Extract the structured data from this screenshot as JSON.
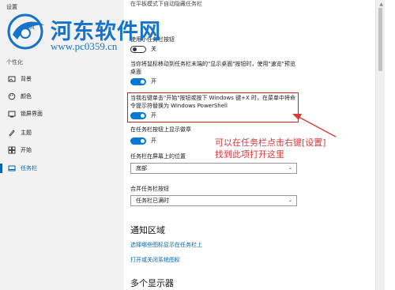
{
  "window": {
    "title": "设置"
  },
  "sidebar": {
    "home_label": "主页",
    "section": "个性化",
    "items": [
      {
        "label": "背景",
        "icon": "image-icon"
      },
      {
        "label": "颜色",
        "icon": "palette-icon"
      },
      {
        "label": "锁屏界面",
        "icon": "lockscreen-icon"
      },
      {
        "label": "主题",
        "icon": "theme-icon"
      },
      {
        "label": "开始",
        "icon": "start-icon"
      },
      {
        "label": "任务栏",
        "icon": "taskbar-icon",
        "active": true
      }
    ]
  },
  "content": {
    "cut_text": "在平板模式下自动隐藏任务栏",
    "small_buttons": {
      "label": "使用小任务栏按钮",
      "toggle": "关",
      "on": false
    },
    "peek": {
      "label": "当你将鼠标移动到任务栏末端的\"显示桌面\"按钮时，使用\"速览\"预览桌面",
      "toggle": "开",
      "on": true
    },
    "powershell": {
      "label": "当我右键单击\"开始\"按钮或按下 Windows 键+X 时，在菜单中将命令提示符替换为 Windows PowerShell",
      "toggle": "开",
      "on": true
    },
    "badges": {
      "label": "在任务栏按钮上显示徽章",
      "toggle": "开",
      "on": true
    },
    "location": {
      "label": "任务栏在屏幕上的位置",
      "value": "底部"
    },
    "combine": {
      "label": "合并任务栏按钮",
      "value": "任务栏已满时"
    },
    "notification": {
      "title": "通知区域",
      "link1": "选择哪些图标显示在任务栏上",
      "link2": "打开或关闭系统图标"
    },
    "multi_display": {
      "title": "多个显示器"
    }
  },
  "annotation": {
    "text": "可以在任务栏点击右键[设置] 找到此项打开这里",
    "color": "#d93a3a"
  },
  "watermark": {
    "title": "河东软件网",
    "url": "www.pc0359.cn"
  },
  "colors": {
    "accent": "#0078d7",
    "link": "#0063b1",
    "highlight": "#d21f1f"
  }
}
